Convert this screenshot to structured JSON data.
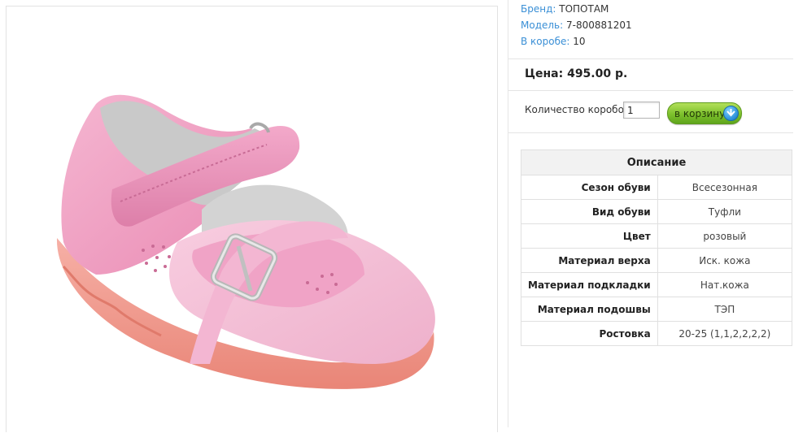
{
  "product": {
    "image_alt": "pink children's shoe",
    "brand_label": "Бренд:",
    "brand": "ТОПОТАМ",
    "model_label": "Модель:",
    "model": "7-800881201",
    "box_label": "В коробе:",
    "box_qty": "10"
  },
  "price": {
    "label": "Цена:",
    "value": "495.00 р."
  },
  "order": {
    "qty_label": "Количество коробов:",
    "qty_value": "1",
    "cart_label": "в корзину",
    "cart_icon": "arrow-down-icon"
  },
  "description": {
    "title": "Описание",
    "rows": [
      {
        "key": "Сезон обуви",
        "value": "Всесезонная"
      },
      {
        "key": "Вид обуви",
        "value": "Туфли"
      },
      {
        "key": "Цвет",
        "value": "розовый"
      },
      {
        "key": "Материал верха",
        "value": "Иск. кожа"
      },
      {
        "key": "Материал подкладки",
        "value": "Нат.кожа"
      },
      {
        "key": "Материал подошвы",
        "value": "ТЭП"
      },
      {
        "key": "Ростовка",
        "value": "20-25 (1,1,2,2,2,2)"
      }
    ]
  },
  "colors": {
    "link": "#3a8fd6",
    "button_green": "#7cc02c",
    "shoe_pink": "#ee9ec0",
    "sole_coral": "#f29a8a"
  }
}
